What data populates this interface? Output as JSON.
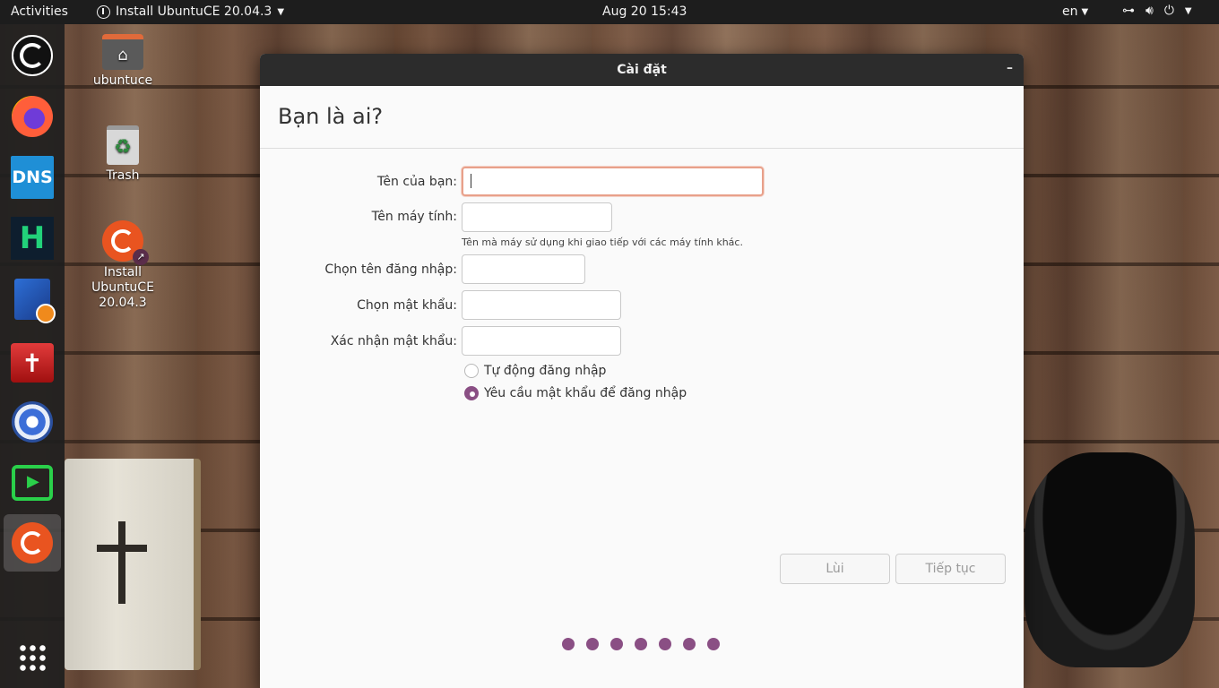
{
  "topbar": {
    "activities": "Activities",
    "app_menu": "Install UbuntuCE 20.04.3",
    "clock": "Aug 20  15:43",
    "lang": "en"
  },
  "dock": {
    "items": [
      {
        "icon": "ubuntu-icon"
      },
      {
        "icon": "firefox-icon"
      },
      {
        "icon": "dns-icon",
        "label": "DNS"
      },
      {
        "icon": "h-app-icon",
        "label": "H"
      },
      {
        "icon": "book-app-icon"
      },
      {
        "icon": "red-app-icon"
      },
      {
        "icon": "swirl-app-icon"
      },
      {
        "icon": "green-app-icon"
      },
      {
        "icon": "ubuntuce-installer-icon"
      },
      {
        "icon": "app-grid-icon"
      }
    ]
  },
  "desktop": {
    "icons": [
      {
        "label": "ubuntuce"
      },
      {
        "label": "Trash"
      },
      {
        "label": "Install UbuntuCE 20.04.3"
      }
    ]
  },
  "window": {
    "title": "Cài đặt",
    "heading": "Bạn là ai?",
    "fields": {
      "name_label": "Tên của bạn:",
      "name_value": "",
      "computer_label": "Tên máy tính:",
      "computer_value": "",
      "computer_hint": "Tên mà máy sử dụng khi giao tiếp với các máy tính khác.",
      "username_label": "Chọn tên đăng nhập:",
      "username_value": "",
      "password_label": "Chọn mật khẩu:",
      "password_value": "",
      "confirm_label": "Xác nhận mật khẩu:",
      "confirm_value": ""
    },
    "login_options": {
      "auto_login": "Tự động đăng nhập",
      "require_password": "Yêu cầu mật khẩu để đăng nhập",
      "selected": "require_password"
    },
    "buttons": {
      "back": "Lùi",
      "continue": "Tiếp tục"
    },
    "progress": {
      "total_steps": 7
    }
  },
  "colors": {
    "accent": "#8a4f84",
    "focus_border": "#e8a08a",
    "titlebar": "#2c2c2c"
  }
}
